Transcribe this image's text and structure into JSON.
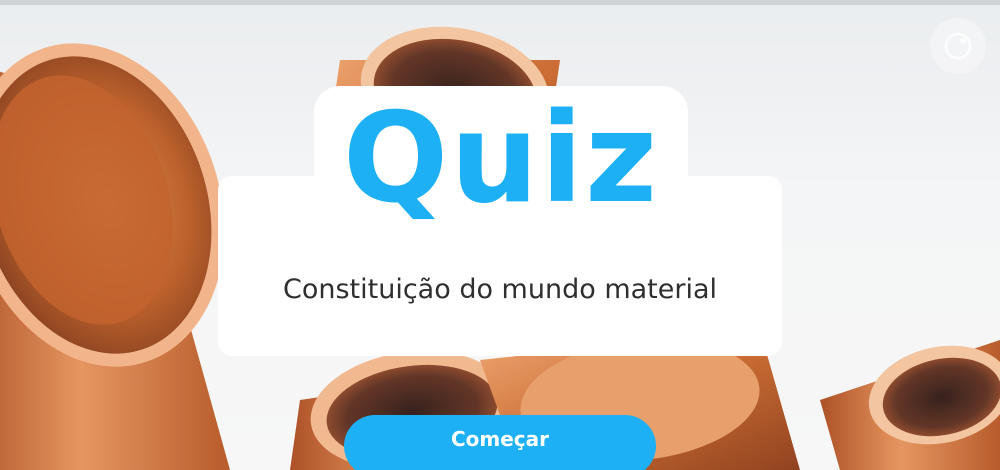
{
  "quiz": {
    "title": "Quiz",
    "subtitle": "Constituição do mundo material",
    "start_label": "Começar"
  },
  "theme": {
    "accent": "#1eb0f5",
    "copper": "#c8642a",
    "card_background": "#ffffff",
    "subtitle_color": "#2f2f2f"
  },
  "icons": {
    "corner": "corner-logo-icon"
  }
}
